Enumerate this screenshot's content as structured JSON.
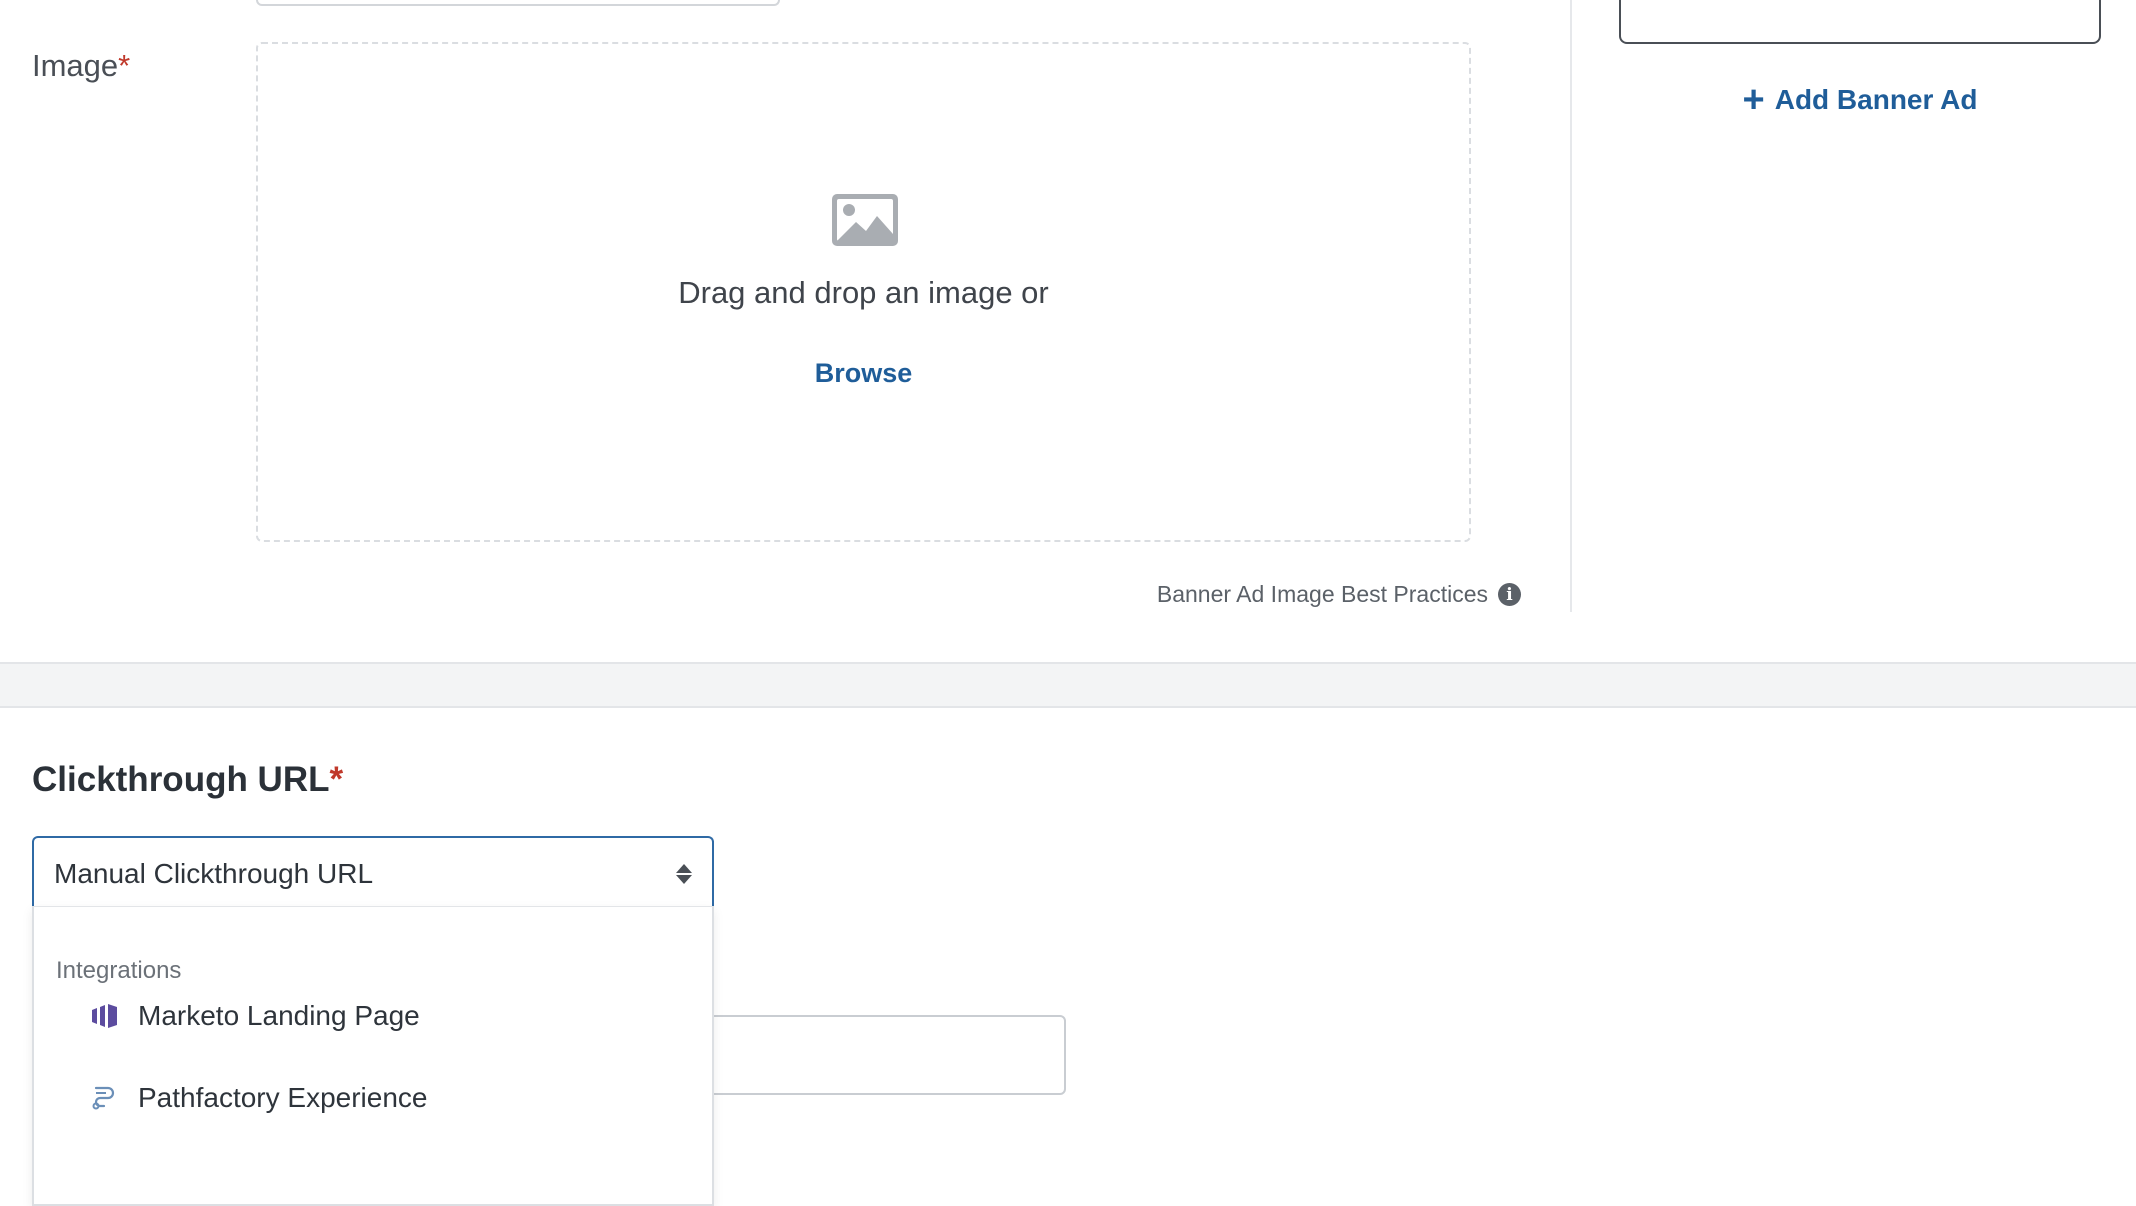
{
  "image_field": {
    "label": "Image",
    "required_marker": "*",
    "dropzone_text": "Drag and drop an image or",
    "browse_label": "Browse",
    "best_practices_label": "Banner Ad Image Best Practices",
    "info_icon": "info-icon"
  },
  "sidebar": {
    "add_banner_label": "Add Banner Ad",
    "add_icon": "plus-icon"
  },
  "clickthrough": {
    "title": "Clickthrough URL",
    "required_marker": "*",
    "select_value": "Manual Clickthrough URL",
    "dropdown": {
      "group_label": "Integrations",
      "options": [
        {
          "label": "Marketo Landing Page",
          "icon": "marketo-icon"
        },
        {
          "label": "Pathfactory Experience",
          "icon": "pathfactory-icon"
        }
      ]
    }
  },
  "colors": {
    "accent": "#1f5d99",
    "required": "#c0392b",
    "focus_border": "#2f6aa5",
    "marketo": "#5c4c9f"
  }
}
